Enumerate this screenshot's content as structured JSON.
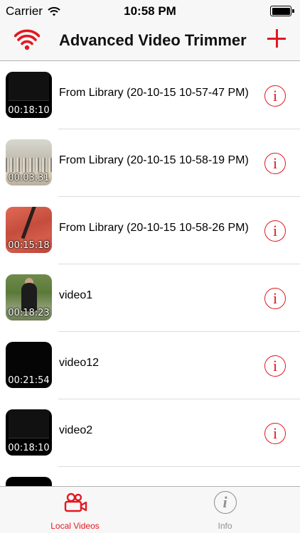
{
  "status_bar": {
    "carrier": "Carrier",
    "time": "10:58 PM"
  },
  "nav_bar": {
    "title": "Advanced Video Trimmer",
    "left_icon": "wifi-icon",
    "right_icon": "plus-icon",
    "accent_color": "#e3181f"
  },
  "videos": [
    {
      "title": "From Library (20-10-15 10-57-47 PM)",
      "duration": "00:18:10"
    },
    {
      "title": "From Library (20-10-15 10-58-19 PM)",
      "duration": "00:03:31"
    },
    {
      "title": "From Library (20-10-15 10-58-26 PM)",
      "duration": "00:15:18"
    },
    {
      "title": "video1",
      "duration": "00:18:23"
    },
    {
      "title": "video12",
      "duration": "00:21:54"
    },
    {
      "title": "video2",
      "duration": "00:18:10"
    },
    {
      "title": "",
      "duration": ""
    }
  ],
  "tab_bar": {
    "tabs": [
      {
        "label": "Local Videos",
        "icon": "video-camera-icon",
        "selected": true
      },
      {
        "label": "Info",
        "icon": "info-icon",
        "selected": false
      }
    ]
  }
}
